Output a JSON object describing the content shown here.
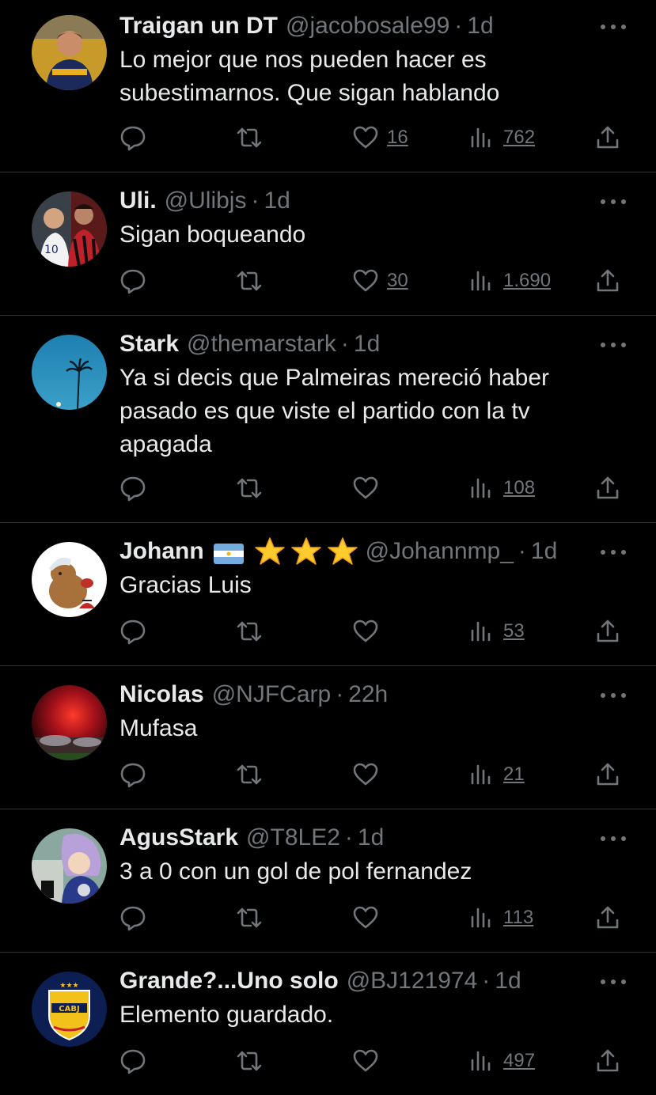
{
  "tweets": [
    {
      "display_name": "Traigan un DT",
      "handle": "@jacobosale99",
      "separator": "·",
      "time": "1d",
      "text": "Lo mejor que nos pueden hacer es subestimarnos. Que sigan hablando",
      "likes": "16",
      "views": "762"
    },
    {
      "display_name": "Uli.",
      "handle": "@Ulibjs",
      "separator": "·",
      "time": "1d",
      "text": "Sigan boqueando",
      "likes": "30",
      "views": "1.690"
    },
    {
      "display_name": "Stark",
      "handle": "@themarstark",
      "separator": "·",
      "time": "1d",
      "text": "Ya si decis que Palmeiras mereció haber pasado es que viste el partido con la tv apagada",
      "likes": "",
      "views": "108"
    },
    {
      "display_name": "Johann",
      "handle": "@Johannmp_",
      "separator": "·",
      "time": "1d",
      "text": "Gracias Luis",
      "likes": "",
      "views": "53"
    },
    {
      "display_name": "Nicolas",
      "handle": "@NJFCarp",
      "separator": "·",
      "time": "22h",
      "text": "Mufasa",
      "likes": "",
      "views": "21"
    },
    {
      "display_name": "AgusStark",
      "handle": "@T8LE2",
      "separator": "·",
      "time": "1d",
      "text": "3 a 0 con un gol de pol fernandez",
      "likes": "",
      "views": "113"
    },
    {
      "display_name": "Grande?...Uno solo",
      "handle": "@BJ121974",
      "separator": "·",
      "time": "1d",
      "text": "Elemento guardado.",
      "likes": "",
      "views": "497"
    }
  ],
  "avatar_badge_text": "CABJ",
  "icons": {
    "reply": "reply-icon",
    "retweet": "retweet-icon",
    "like": "heart-icon",
    "views": "views-icon",
    "share": "share-icon",
    "more": "more-icon"
  },
  "colors": {
    "background": "#000000",
    "primary_text": "#e7e9ea",
    "secondary_text": "#71767b",
    "divider": "#2f3336"
  }
}
